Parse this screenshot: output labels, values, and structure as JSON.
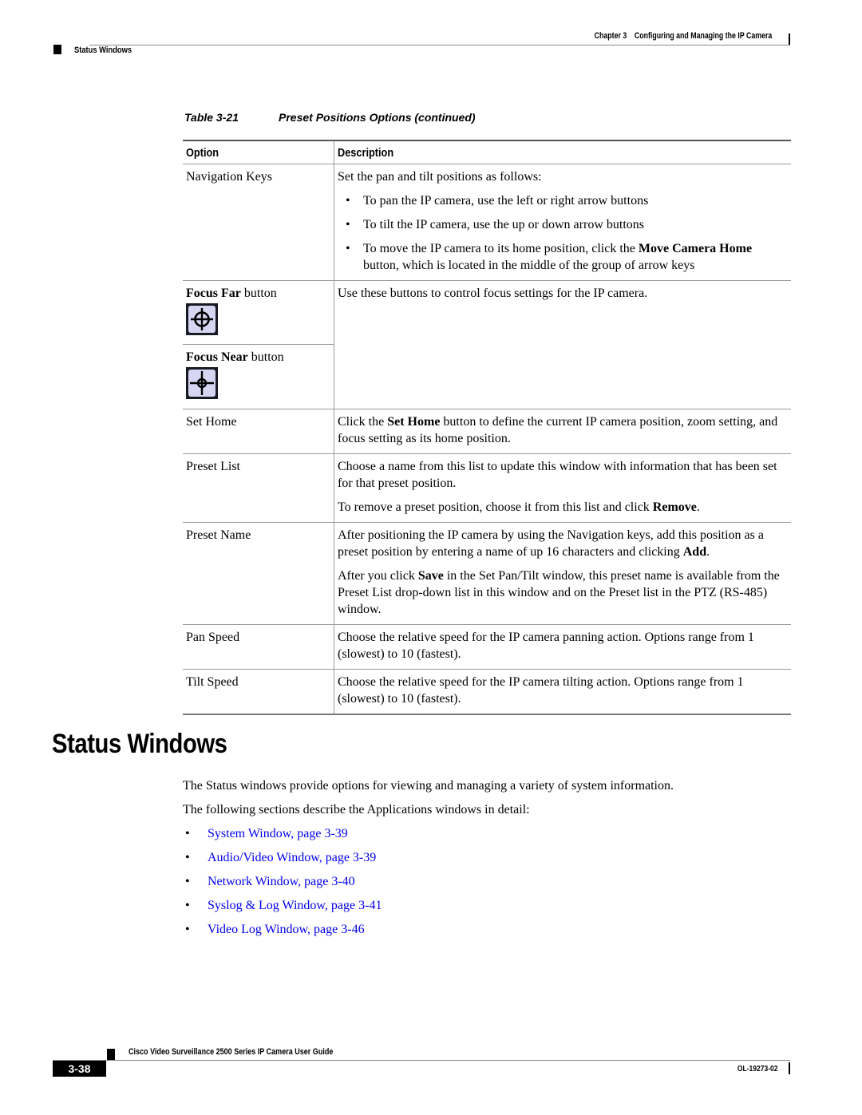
{
  "header": {
    "chapter": "Chapter 3",
    "chapter_title": "Configuring and Managing the IP Camera",
    "section": "Status Windows"
  },
  "table": {
    "number": "Table 3-21",
    "title": "Preset Positions Options (continued)",
    "headers": {
      "option": "Option",
      "description": "Description"
    },
    "rows": {
      "navigation_keys": {
        "option": "Navigation Keys",
        "intro": "Set the pan and tilt positions as follows:",
        "bullets": [
          "To pan the IP camera, use the left or right arrow buttons",
          "To tilt the IP camera, use the up or down arrow buttons"
        ],
        "bullet3_pre": "To move the IP camera to its home position, click the ",
        "bullet3_bold": "Move Camera Home",
        "bullet3_post": " button, which is located in the middle of the group of arrow keys"
      },
      "focus": {
        "far_bold": "Focus Far",
        "far_suffix": " button",
        "far_icon": "focus-far-icon",
        "near_bold": "Focus Near",
        "near_suffix": " button",
        "near_icon": "focus-near-icon",
        "description": "Use these buttons to control focus settings for the IP camera."
      },
      "set_home": {
        "option": "Set Home",
        "pre": "Click the ",
        "bold": "Set Home",
        "post": " button to define the current IP camera position, zoom setting, and focus setting as its home position."
      },
      "preset_list": {
        "option": "Preset List",
        "p1": "Choose a name from this list to update this window with information that has been set for that preset position.",
        "p2_pre": "To remove a preset position, choose it from this list and click ",
        "p2_bold": "Remove",
        "p2_post": "."
      },
      "preset_name": {
        "option": "Preset Name",
        "p1_pre": "After positioning the IP camera by using the Navigation keys, add this position as a preset position by entering a name of up 16 characters and clicking ",
        "p1_bold": "Add",
        "p1_post": ".",
        "p2_pre": "After you click ",
        "p2_bold": "Save",
        "p2_post": " in the Set Pan/Tilt window, this preset name is available from the Preset List drop-down list in this window and on the Preset list in the PTZ (RS-485) window."
      },
      "pan_speed": {
        "option": "Pan Speed",
        "description": "Choose the relative speed for the IP camera panning action. Options range from 1 (slowest) to 10 (fastest)."
      },
      "tilt_speed": {
        "option": "Tilt Speed",
        "description": "Choose the relative speed for the IP camera tilting action. Options range from 1 (slowest) to 10 (fastest)."
      }
    }
  },
  "section": {
    "title": "Status Windows",
    "p1": "The Status windows provide options for viewing and managing a variety of system information.",
    "p2": "The following sections describe the Applications windows in detail:",
    "links": [
      "System Window, page 3-39",
      "Audio/Video Window, page 3-39",
      "Network Window, page 3-40",
      "Syslog & Log Window, page 3-41",
      "Video Log Window, page 3-46"
    ],
    "link_color": "#0000ee"
  },
  "footer": {
    "guide_title": "Cisco Video Surveillance 2500 Series IP Camera User Guide",
    "page_number": "3-38",
    "doc_number": "OL-19273-02"
  },
  "bullet_glyph": "•"
}
